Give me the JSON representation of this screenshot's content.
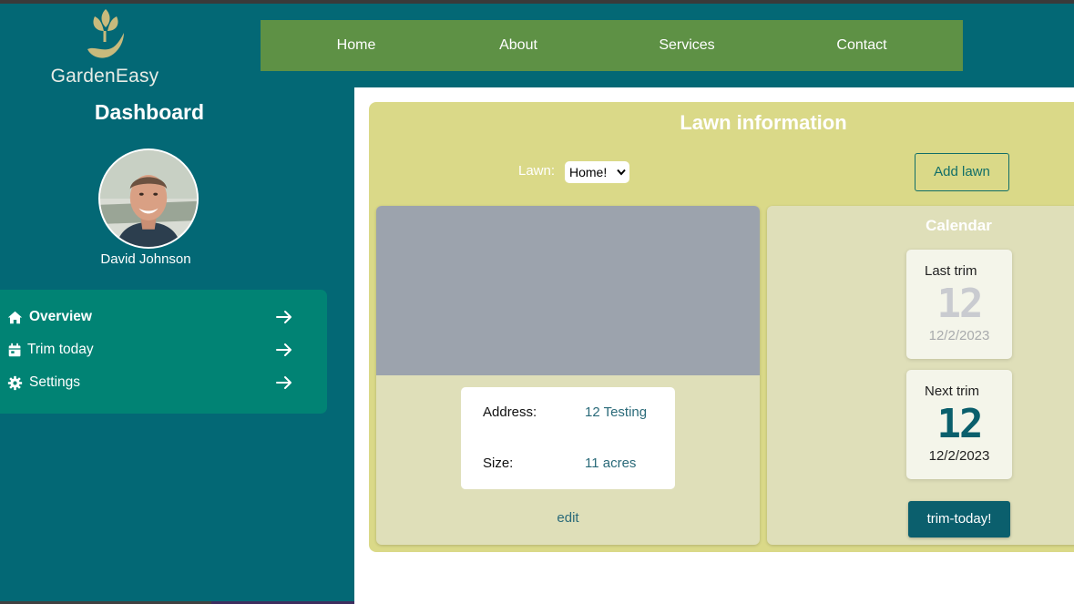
{
  "brand": {
    "name": "GardenEasy",
    "logo_icon": "leaf-hand-icon"
  },
  "nav": {
    "items": [
      {
        "label": "Home"
      },
      {
        "label": "About"
      },
      {
        "label": "Services"
      },
      {
        "label": "Contact"
      }
    ]
  },
  "sidebar": {
    "title": "Dashboard",
    "user": {
      "name": "David Johnson"
    },
    "items": [
      {
        "label": "Overview",
        "icon": "home-icon",
        "active": true
      },
      {
        "label": "Trim today",
        "icon": "calendar-icon"
      },
      {
        "label": "Settings",
        "icon": "gear-icon"
      }
    ]
  },
  "lawn": {
    "title": "Lawn information",
    "select_label": "Lawn:",
    "selected": "Home!",
    "add_button": "Add lawn",
    "address_label": "Address:",
    "address_value": "12 Testing",
    "size_label": "Size:",
    "size_value": "11 acres",
    "edit_label": "edit"
  },
  "calendar": {
    "title": "Calendar",
    "last_trim": {
      "label": "Last trim",
      "day": "12",
      "date": "12/2/2023"
    },
    "next_trim": {
      "label": "Next trim",
      "day": "12",
      "date": "12/2/2023"
    },
    "trim_button": "trim-today!"
  },
  "colors": {
    "background": "#036875",
    "nav": "#5e9145",
    "menu": "#018374",
    "panel": "#dad988",
    "card": "#dfdfb9",
    "accent": "#0b5f6d"
  }
}
